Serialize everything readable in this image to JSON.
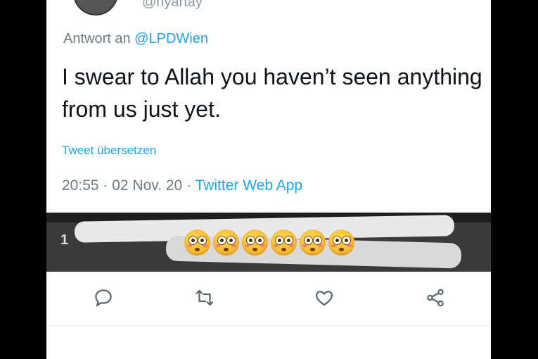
{
  "tweet": {
    "handle": "@nyartay",
    "reply_prefix": "Antwort an ",
    "reply_mention": "@LPDWien",
    "text": "I swear to Allah you haven’t seen anything from us just yet.",
    "translate_label": "Tweet übersetzen",
    "time": "20:55",
    "date": "02 Nov. 20",
    "separator": " · ",
    "source": "Twitter Web App"
  },
  "overlay": {
    "digit": "1",
    "emoji": [
      "flushed-face-emoji",
      "flushed-face-emoji",
      "flushed-face-emoji",
      "flushed-face-emoji",
      "flushed-face-emoji",
      "flushed-face-emoji"
    ]
  },
  "actions": [
    "reply-icon",
    "retweet-icon",
    "like-icon",
    "share-icon"
  ],
  "colors": {
    "accent": "#1da1f2",
    "secondary_text": "#6f7b86",
    "primary_text": "#0f1419"
  }
}
